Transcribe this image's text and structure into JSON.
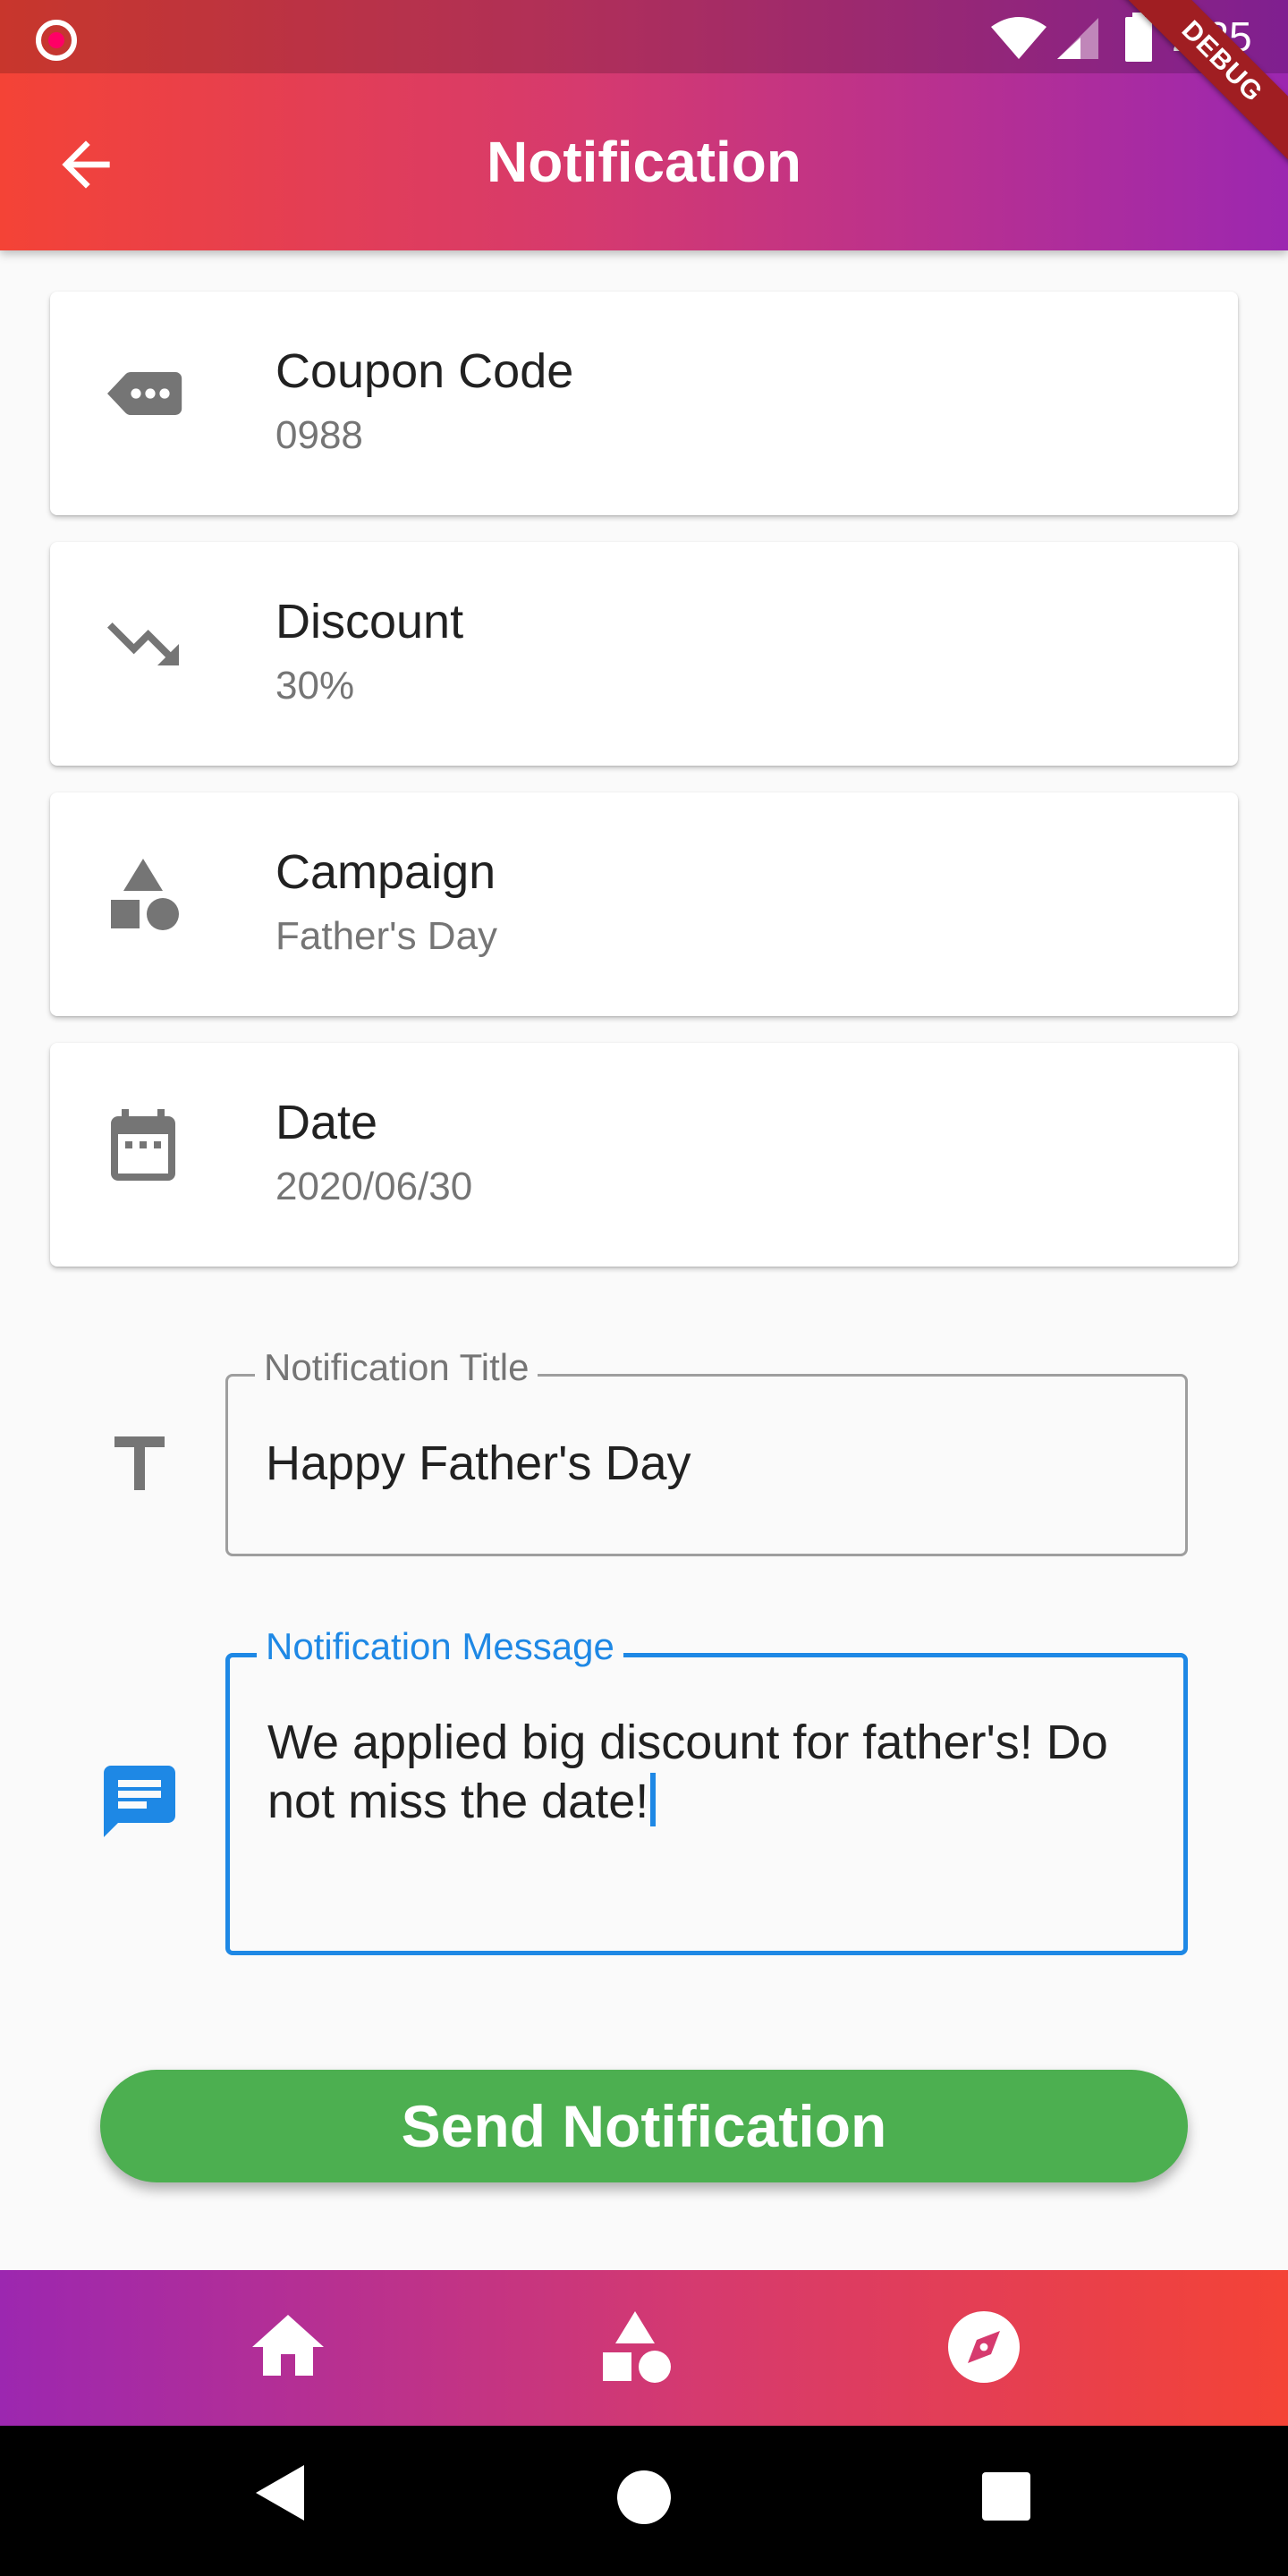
{
  "status_bar": {
    "time": "2:25",
    "icons": [
      "record-icon",
      "wifi-icon",
      "signal-icon",
      "battery-icon"
    ],
    "debug_banner": "DEBUG"
  },
  "app_bar": {
    "title": "Notification",
    "back_icon": "arrow-back-icon",
    "gradient": [
      "#f44336",
      "#9c27b0"
    ]
  },
  "cards": [
    {
      "icon": "tag-icon",
      "title": "Coupon Code",
      "value": "0988"
    },
    {
      "icon": "trending-down-icon",
      "title": "Discount",
      "value": "30%"
    },
    {
      "icon": "shapes-icon",
      "title": "Campaign",
      "value": "Father's Day"
    },
    {
      "icon": "calendar-icon",
      "title": "Date",
      "value": "2020/06/30"
    }
  ],
  "form": {
    "title_field": {
      "icon": "title-text-icon",
      "label": "Notification Title",
      "value": "Happy Father's Day"
    },
    "message_field": {
      "icon": "message-icon",
      "label": "Notification Message",
      "value": "We applied big discount for father's! Do not miss the date!",
      "focused": true,
      "accent": "#1e88e5"
    }
  },
  "send_button": {
    "label": "Send Notification",
    "color": "#4caf50"
  },
  "bottom_nav": {
    "items": [
      "home-icon",
      "shapes-icon",
      "explore-icon"
    ],
    "gradient": [
      "#9c27b0",
      "#f44336"
    ]
  },
  "system_nav": {
    "items": [
      "back",
      "home",
      "recents"
    ]
  }
}
